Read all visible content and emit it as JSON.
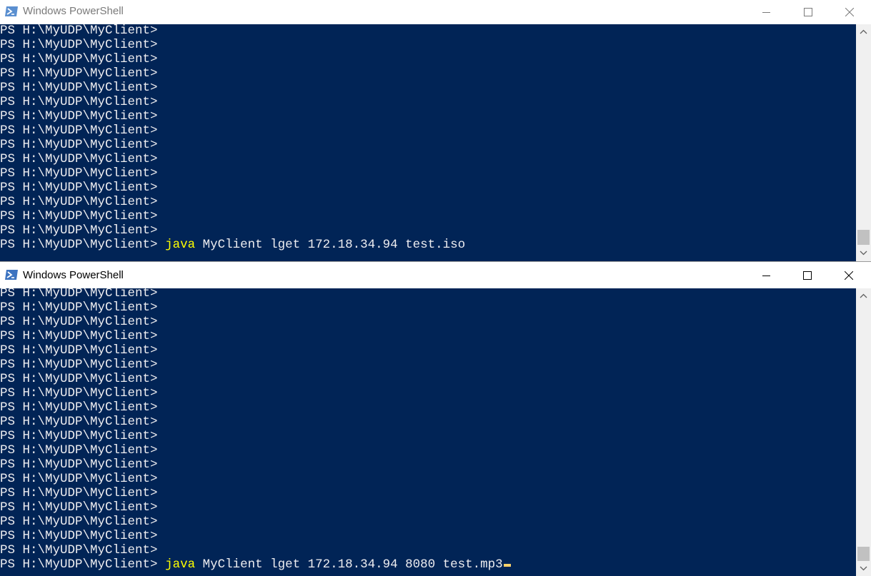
{
  "windows": [
    {
      "title": "Windows PowerShell",
      "prompt": "PS H:\\MyUDP\\MyClient>",
      "prompt_line_count": 15,
      "last_line": {
        "prompt": "PS H:\\MyUDP\\MyClient>",
        "keyword": "java",
        "args": "MyClient lget 172.18.34.94 test.iso"
      }
    },
    {
      "title": "Windows PowerShell",
      "prompt": "PS H:\\MyUDP\\MyClient>",
      "prompt_line_count": 19,
      "last_line": {
        "prompt": "PS H:\\MyUDP\\MyClient>",
        "keyword": "java",
        "args": "MyClient lget 172.18.34.94 8080 test.mp3"
      }
    }
  ],
  "icons": {
    "app": "powershell-icon",
    "minimize": "minimize-icon",
    "maximize": "maximize-icon",
    "close": "close-icon",
    "scroll_up": "chevron-up-icon",
    "scroll_down": "chevron-down-icon"
  },
  "colors": {
    "console_bg": "#012456",
    "console_text": "#eeedf0",
    "keyword": "#ffff00",
    "cursor": "#ffd36b"
  }
}
